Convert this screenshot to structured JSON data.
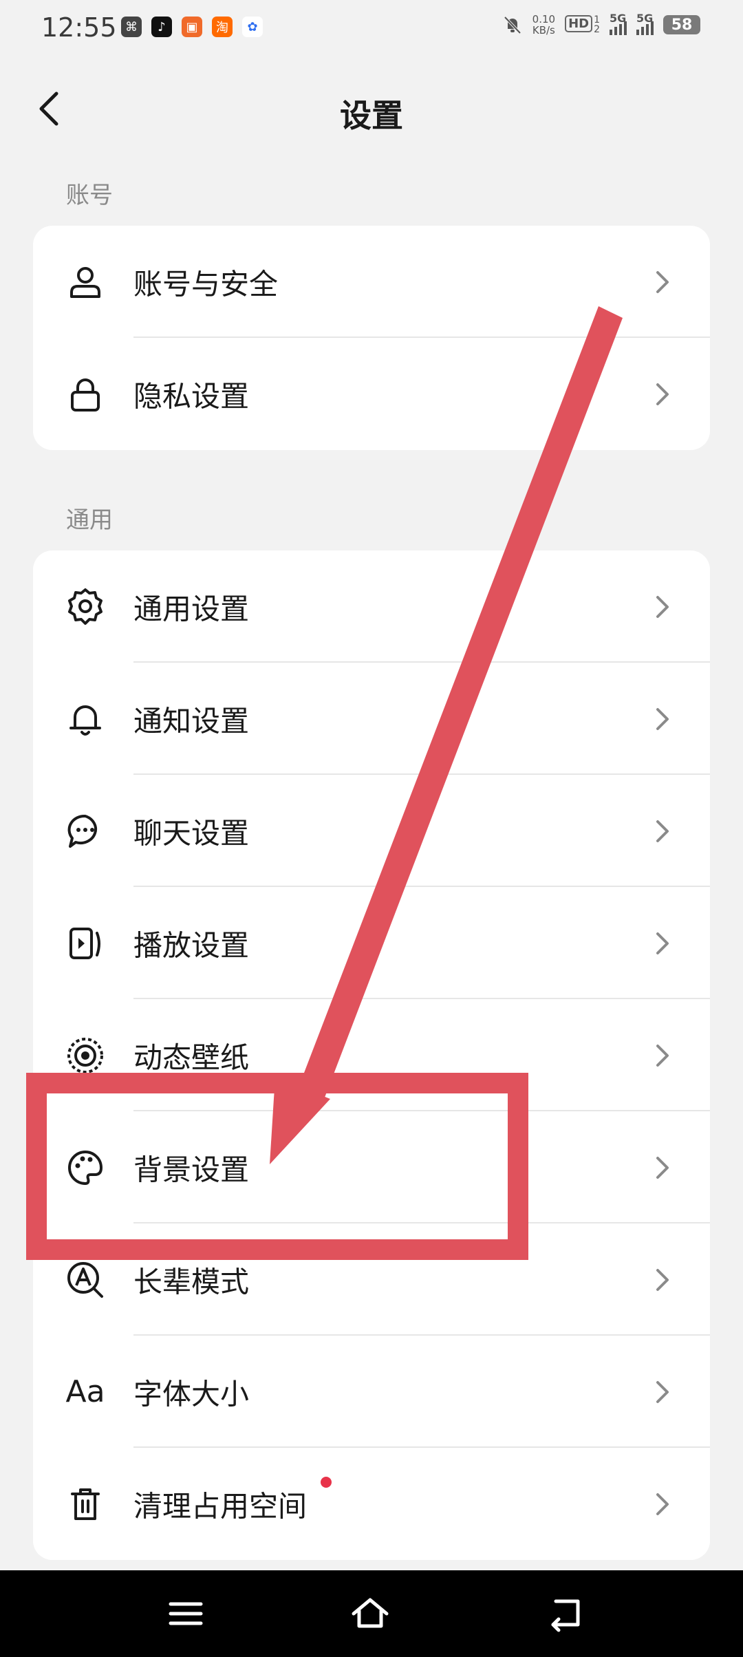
{
  "status_bar": {
    "time": "12:55",
    "net_speed": "0.10",
    "net_unit": "KB/s",
    "hd_label": "HD",
    "sim1": "1",
    "sim2": "2",
    "signal1_label": "5G",
    "signal2_label": "5G",
    "battery": "58"
  },
  "header": {
    "title": "设置"
  },
  "sections": [
    {
      "label": "账号",
      "items": [
        {
          "label": "账号与安全",
          "icon": "user-icon"
        },
        {
          "label": "隐私设置",
          "icon": "lock-icon"
        }
      ]
    },
    {
      "label": "通用",
      "items": [
        {
          "label": "通用设置",
          "icon": "gear-icon"
        },
        {
          "label": "通知设置",
          "icon": "bell-icon"
        },
        {
          "label": "聊天设置",
          "icon": "chat-bubble-icon"
        },
        {
          "label": "播放设置",
          "icon": "play-icon"
        },
        {
          "label": "动态壁纸",
          "icon": "live-wallpaper-icon"
        },
        {
          "label": "背景设置",
          "icon": "palette-icon"
        },
        {
          "label": "长辈模式",
          "icon": "elder-mode-icon"
        },
        {
          "label": "字体大小",
          "icon": "font-size-icon",
          "icon_text": "Aa"
        },
        {
          "label": "清理占用空间",
          "icon": "trash-icon",
          "badge": "red-dot"
        }
      ]
    }
  ],
  "colors": {
    "annotation": "#e0525c",
    "badge": "#e8334a",
    "background": "#f2f2f2",
    "card": "#ffffff"
  }
}
